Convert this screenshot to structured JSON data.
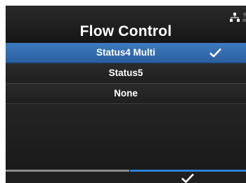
{
  "header": {
    "title": "Flow Control",
    "icons": [
      "network-icon"
    ]
  },
  "options": [
    {
      "label": "Status4 Multi",
      "selected": true
    },
    {
      "label": "Status5",
      "selected": false
    },
    {
      "label": "None",
      "selected": false
    }
  ],
  "footer": {
    "left_button": "back",
    "right_button": "confirm"
  },
  "colors": {
    "accent": "#2f7fd6",
    "selected_row": "#3e7bc0",
    "background": "#1b1b1b",
    "text": "#ffffff"
  }
}
